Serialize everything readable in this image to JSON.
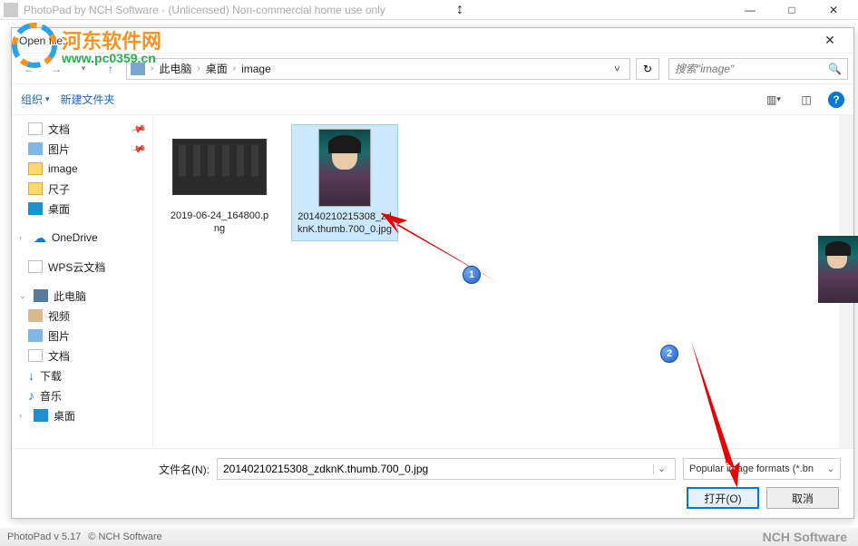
{
  "app": {
    "title": "PhotoPad by NCH Software - (Unlicensed) Non-commercial home use only",
    "min": "—",
    "max": "□",
    "close": "✕"
  },
  "watermark": {
    "text1": "河东软件网",
    "text2": "www.pc0359.cn"
  },
  "dialog": {
    "title": "Open file...",
    "close": "✕",
    "nav": {
      "pc": "此电脑",
      "desktop": "桌面",
      "folder": "image",
      "search_ph": "搜索\"image\""
    },
    "cmdbar": {
      "organize": "组织",
      "newfolder": "新建文件夹",
      "help": "?"
    },
    "sidebar": {
      "items": [
        {
          "exp": "",
          "ico": "ico-doc",
          "label": "文档",
          "pin": true
        },
        {
          "exp": "",
          "ico": "ico-pics",
          "label": "图片",
          "pin": true
        },
        {
          "exp": "",
          "ico": "ico-folder",
          "label": "image",
          "pin": false
        },
        {
          "exp": "",
          "ico": "ico-folder",
          "label": "尺子",
          "pin": false
        },
        {
          "exp": "",
          "ico": "ico-desktop",
          "label": "桌面",
          "pin": false
        }
      ],
      "onedrive": "OneDrive",
      "wps": "WPS云文档",
      "thispc": "此电脑",
      "pcitems": [
        {
          "ico": "ico-video",
          "label": "视频"
        },
        {
          "ico": "ico-pics",
          "label": "图片"
        },
        {
          "ico": "ico-doc",
          "label": "文档"
        },
        {
          "ico": "ico-down",
          "label": "下载"
        },
        {
          "ico": "ico-music",
          "label": "音乐"
        },
        {
          "ico": "ico-desktop",
          "label": "桌面"
        }
      ]
    },
    "files": [
      {
        "name": "2019-06-24_164800.png",
        "selected": false,
        "type": "dark"
      },
      {
        "name": "20140210215308_zdknK.thumb.700_0.jpg",
        "selected": true,
        "type": "portrait"
      }
    ],
    "filename_label": "文件名(N):",
    "filename_value": "20140210215308_zdknK.thumb.700_0.jpg",
    "filetype": "Popular image formats (*.bn",
    "open_btn": "打开(O)",
    "cancel_btn": "取消"
  },
  "status": {
    "version": "PhotoPad v 5.17",
    "copyright": "© NCH Software",
    "brand": "NCH Software"
  },
  "annotations": {
    "n1": "1",
    "n2": "2"
  },
  "resize_cursor": "↕"
}
